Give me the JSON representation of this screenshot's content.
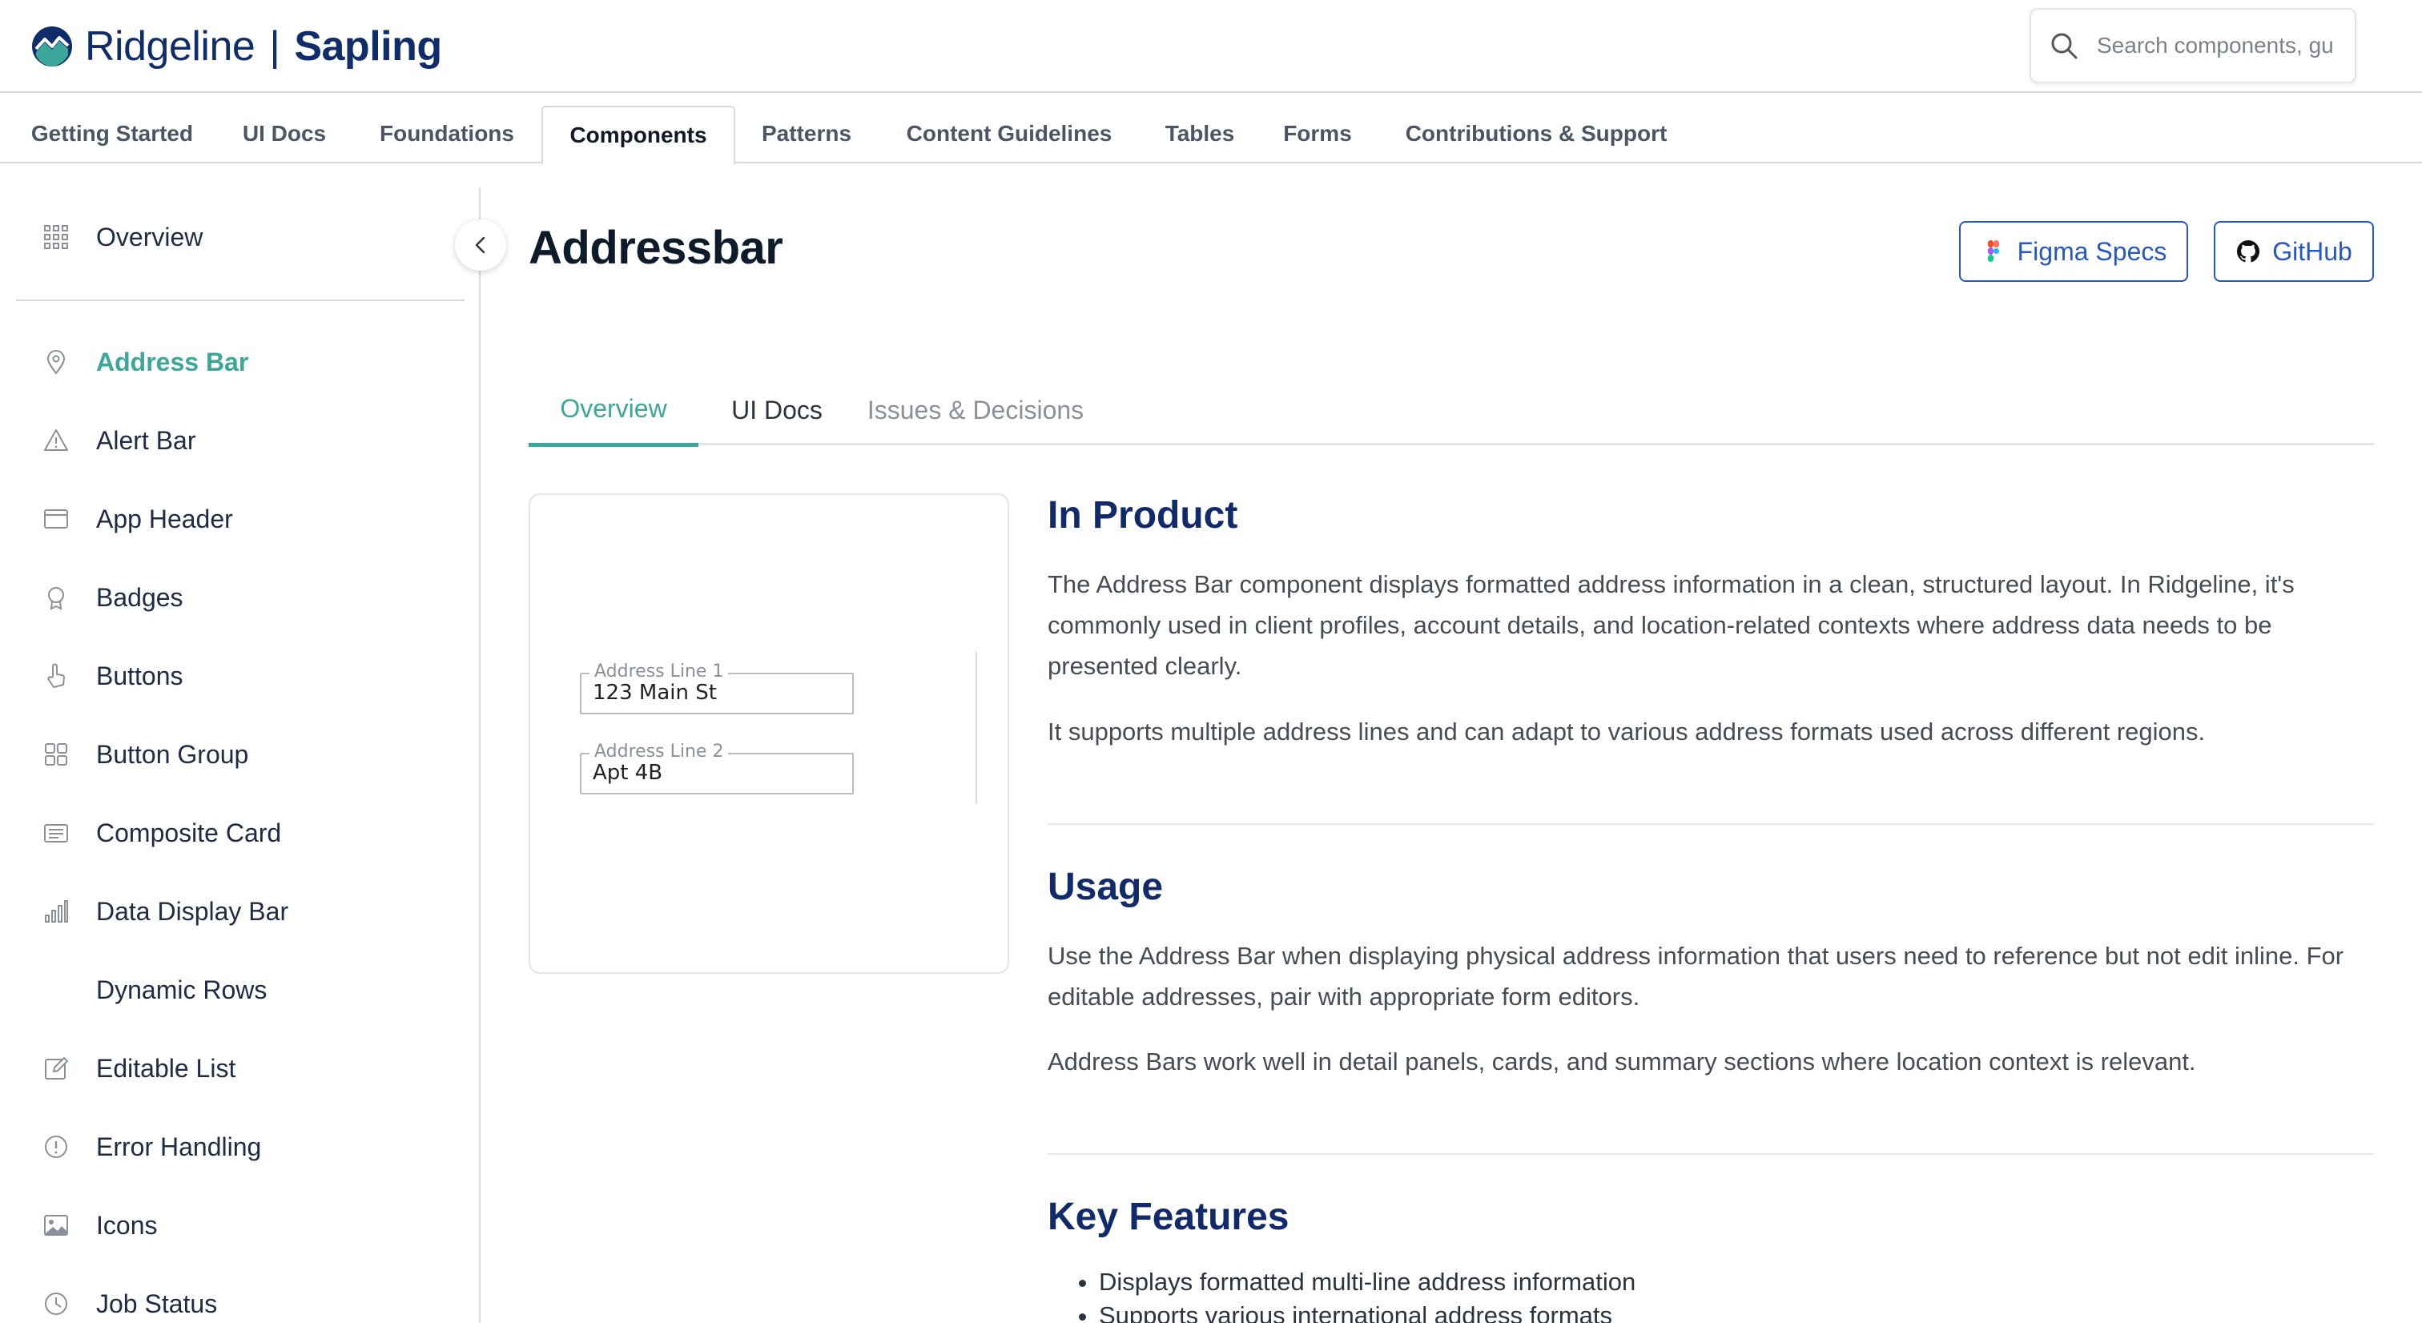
{
  "header": {
    "brand_name": "Ridgeline",
    "brand_separator": "|",
    "product_name": "Sapling",
    "search_placeholder": "Search components, gu"
  },
  "topnav": {
    "tabs": [
      {
        "label": "Getting Started"
      },
      {
        "label": "UI Docs"
      },
      {
        "label": "Foundations"
      },
      {
        "label": "Components",
        "active": true
      },
      {
        "label": "Patterns"
      },
      {
        "label": "Content Guidelines"
      },
      {
        "label": "Tables"
      },
      {
        "label": "Forms"
      },
      {
        "label": "Contributions & Support"
      }
    ]
  },
  "sidebar": {
    "overview_label": "Overview",
    "items": [
      {
        "label": "Address Bar",
        "icon": "map-pin-icon",
        "active": true
      },
      {
        "label": "Alert Bar",
        "icon": "warning-triangle-icon"
      },
      {
        "label": "App Header",
        "icon": "window-icon"
      },
      {
        "label": "Badges",
        "icon": "badge-icon"
      },
      {
        "label": "Buttons",
        "icon": "pointer-hand-icon"
      },
      {
        "label": "Button Group",
        "icon": "grid-squares-icon"
      },
      {
        "label": "Composite Card",
        "icon": "card-list-icon"
      },
      {
        "label": "Data Display Bar",
        "icon": "bar-chart-icon"
      },
      {
        "label": "Dynamic Rows",
        "icon": ""
      },
      {
        "label": "Editable List",
        "icon": "edit-icon"
      },
      {
        "label": "Error Handling",
        "icon": "alert-circle-icon"
      },
      {
        "label": "Icons",
        "icon": "image-icon"
      },
      {
        "label": "Job Status",
        "icon": "clock-icon"
      }
    ]
  },
  "main": {
    "title": "Addressbar",
    "figma_label": "Figma Specs",
    "github_label": "GitHub",
    "subtabs": [
      {
        "label": "Overview",
        "state": "active"
      },
      {
        "label": "UI Docs",
        "state": "normal"
      },
      {
        "label": "Issues & Decisions",
        "state": "muted"
      }
    ],
    "preview": {
      "line1_label": "Address Line 1",
      "line1_value": "123 Main St",
      "line2_label": "Address Line 2",
      "line2_value": "Apt 4B"
    },
    "sections": {
      "in_product": {
        "heading": "In Product",
        "p1": "The Address Bar component displays formatted address information in a clean, structured layout. In Ridgeline, it's commonly used in client profiles, account details, and location-related contexts where address data needs to be presented clearly.",
        "p2": "It supports multiple address lines and can adapt to various address formats used across different regions."
      },
      "usage": {
        "heading": "Usage",
        "p1": "Use the Address Bar when displaying physical address information that users need to reference but not edit inline. For editable addresses, pair with appropriate form editors.",
        "p2": "Address Bars work well in detail panels, cards, and summary sections where location context is relevant."
      },
      "key_features": {
        "heading": "Key Features",
        "bullets": [
          "Displays formatted multi-line address information",
          "Supports various international address formats"
        ]
      }
    }
  },
  "colors": {
    "brand_navy": "#0f2d6b",
    "accent_teal": "#3aa79a",
    "link_blue": "#2557c9"
  }
}
